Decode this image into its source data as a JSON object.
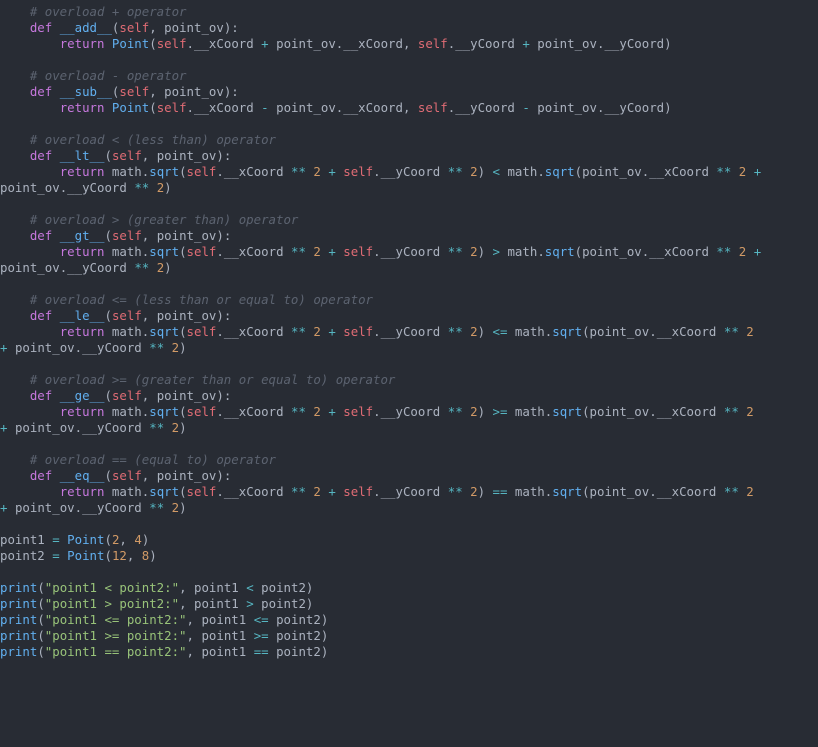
{
  "file": "point_operators.py",
  "language": "python",
  "indent_unit": "    ",
  "comments": {
    "add": "# overload + operator",
    "sub": "# overload - operator",
    "lt": "# overload < (less than) operator",
    "gt": "# overload > (greater than) operator",
    "le": "# overload <= (less than or equal to) operator",
    "ge": "# overload >= (greater than or equal to) operator",
    "eq": "# overload == (equal to) operator"
  },
  "keywords": {
    "def": "def",
    "return": "return"
  },
  "idents": {
    "self": "self",
    "point_ov": "point_ov",
    "Point": "Point",
    "math": "math",
    "sqrt": "sqrt",
    "xCoord": "__xCoord",
    "yCoord": "__yCoord",
    "point1": "point1",
    "point2": "point2",
    "print": "print"
  },
  "method_names": {
    "add": "__add__",
    "sub": "__sub__",
    "lt": "__lt__",
    "gt": "__gt__",
    "le": "__le__",
    "ge": "__ge__",
    "eq": "__eq__"
  },
  "operators": {
    "plus": "+",
    "minus": "-",
    "lt": "<",
    "gt": ">",
    "le": "<=",
    "ge": ">=",
    "eq": "==",
    "pow": "**",
    "assign": "=",
    "comma": ",",
    "dot": ".",
    "lpar": "(",
    "rpar": ")",
    "colon": ":"
  },
  "numbers": {
    "two": "2",
    "four": "4",
    "eight": "8",
    "twelve": "12"
  },
  "strings": {
    "lt": "\"point1 < point2:\"",
    "gt": "\"point1 > point2:\"",
    "le": "\"point1 <= point2:\"",
    "ge": "\"point1 >= point2:\"",
    "eq": "\"point1 == point2:\""
  },
  "chart_data": null
}
